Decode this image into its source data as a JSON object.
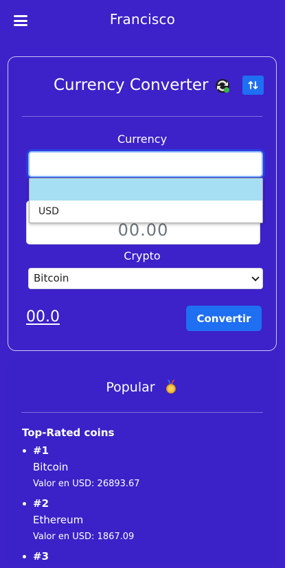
{
  "header": {
    "title": "Francisco",
    "menu_icon": "hamburger-menu-icon"
  },
  "converter": {
    "title": "Currency Converter",
    "title_emoji": "currency-exchange-emoji",
    "swap_icon": "swap-vertical-arrows-icon",
    "currency_label": "Currency",
    "currency_value": "",
    "dropdown_options": [
      "",
      "USD"
    ],
    "amount_placeholder": "00.00",
    "crypto_label": "Crypto",
    "crypto_selected": "Bitcoin",
    "result": "00.0",
    "convert_label": "Convertir"
  },
  "popular": {
    "title": "Popular",
    "title_emoji": "medal-emoji",
    "subtitle": "Top-Rated coins",
    "coins": [
      {
        "rank": "#1",
        "name": "Bitcoin",
        "value": "Valor en USD: 26893.67"
      },
      {
        "rank": "#2",
        "name": "Ethereum",
        "value": "Valor en USD: 1867.09"
      },
      {
        "rank": "#3",
        "name": "",
        "value": ""
      }
    ]
  },
  "colors": {
    "background": "#3d21c9",
    "accent_button": "#1f6ff2",
    "dropdown_highlight": "#a6dff3"
  }
}
